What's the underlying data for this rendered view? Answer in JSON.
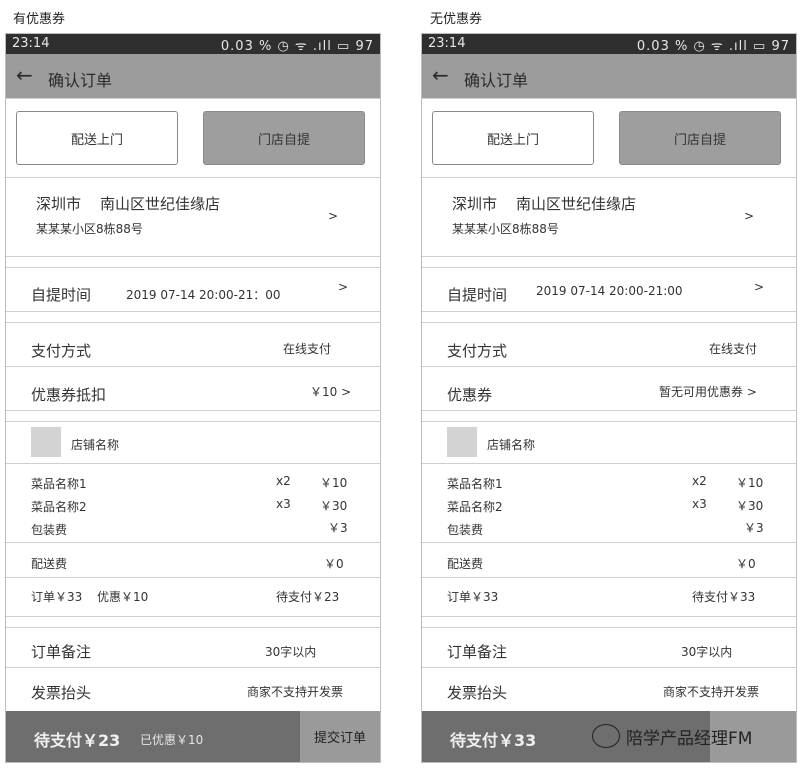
{
  "left": {
    "caption": "有优惠券",
    "status_time": "23:14",
    "status_right": "0.03 % ◷ ᯤ .ıll ▭ 97",
    "title": "确认订单",
    "delivery_label": "配送上门",
    "pickup_label": "门店自提",
    "store_city": "深圳市",
    "store_name": "南山区世纪佳缘店",
    "store_address": "某某某小区8栋88号",
    "chevron": ">",
    "pickup_time_label": "自提时间",
    "pickup_time_value": "2019 07-14 20:00-21：00",
    "payment_label": "支付方式",
    "payment_value": "在线支付",
    "coupon_label": "优惠券抵扣",
    "coupon_value": "￥10 >",
    "shop_name": "店铺名称",
    "items": [
      {
        "name": "菜品名称1",
        "qty": "x2",
        "price": "￥10"
      },
      {
        "name": "菜品名称2",
        "qty": "x3",
        "price": "￥30"
      }
    ],
    "packing_label": "包装费",
    "packing_value": "￥3",
    "delivery_fee_label": "配送费",
    "delivery_fee_value": "￥0",
    "order_total": "订单￥33",
    "discount": "优惠￥10",
    "to_pay": "待支付￥23",
    "remark_label": "订单备注",
    "remark_placeholder": "30字以内",
    "invoice_label": "发票抬头",
    "invoice_value": "商家不支持开发票",
    "bottom_total": "待支付￥23",
    "bottom_discount": "已优惠￥10",
    "submit": "提交订单"
  },
  "right": {
    "caption": "无优惠券",
    "status_time": "23:14",
    "status_right": "0.03 % ◷ ᯤ .ıll ▭ 97",
    "title": "确认订单",
    "delivery_label": "配送上门",
    "pickup_label": "门店自提",
    "store_city": "深圳市",
    "store_name": "南山区世纪佳缘店",
    "store_address": "某某某小区8栋88号",
    "chevron": ">",
    "pickup_time_label": "自提时间",
    "pickup_time_value": "2019 07-14 20:00-21:00",
    "payment_label": "支付方式",
    "payment_value": "在线支付",
    "coupon_label": "优惠券",
    "coupon_value": "暂无可用优惠券 >",
    "shop_name": "店铺名称",
    "items": [
      {
        "name": "菜品名称1",
        "qty": "x2",
        "price": "￥10"
      },
      {
        "name": "菜品名称2",
        "qty": "x3",
        "price": "￥30"
      }
    ],
    "packing_label": "包装费",
    "packing_value": "￥3",
    "delivery_fee_label": "配送费",
    "delivery_fee_value": "￥0",
    "order_total": "订单￥33",
    "to_pay": "待支付￥33",
    "remark_label": "订单备注",
    "remark_placeholder": "30字以内",
    "invoice_label": "发票抬头",
    "invoice_value": "商家不支持开发票",
    "bottom_total": "待支付￥33"
  },
  "watermark": "陪学产品经理FM"
}
